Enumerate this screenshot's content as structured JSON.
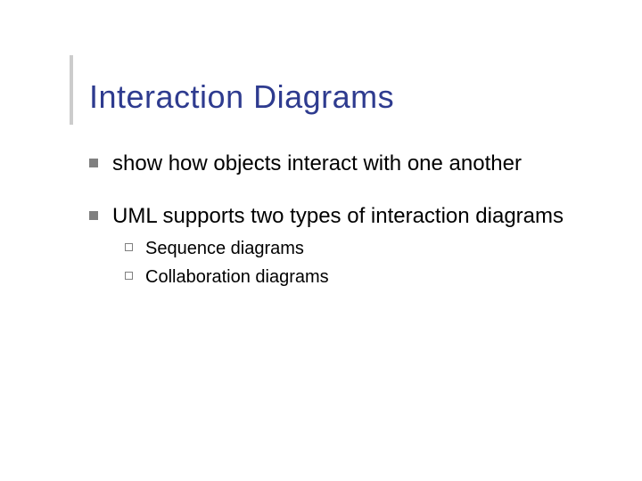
{
  "title": "Interaction Diagrams",
  "bullets": [
    {
      "text": "show how objects interact with one another",
      "subs": []
    },
    {
      "text": "UML supports two types of interaction diagrams",
      "subs": [
        "Sequence diagrams",
        "Collaboration diagrams"
      ]
    }
  ]
}
